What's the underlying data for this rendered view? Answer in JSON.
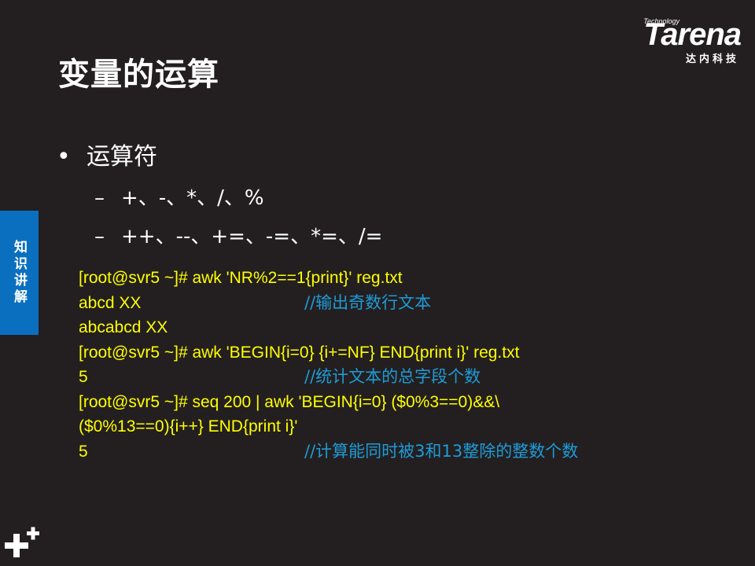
{
  "logo": {
    "technology": "Technology",
    "brand": "Tarena",
    "cn": "达内科技"
  },
  "title": "变量的运算",
  "bullet": "运算符",
  "sub_items": [
    "+、-、*、/、%",
    "++、--、+=、-=、*=、/="
  ],
  "side_tab": "知识讲解",
  "code_lines": [
    {
      "cmd": "[root@svr5 ~]# awk  'NR%2==1{print}'  reg.txt",
      "comment": ""
    },
    {
      "cmd": "abcd XX",
      "comment": "//输出奇数行文本"
    },
    {
      "cmd": "abcabcd XX",
      "comment": ""
    },
    {
      "cmd": "[root@svr5 ~]# awk  'BEGIN{i=0} {i+=NF} END{print i}'  reg.txt",
      "comment": ""
    },
    {
      "cmd": "5",
      "comment": "//统计文本的总字段个数"
    },
    {
      "cmd": "[root@svr5 ~]# seq  200 | awk  'BEGIN{i=0} ($0%3==0)&&\\",
      "comment": ""
    },
    {
      "cmd": "($0%13==0){i++} END{print i}'",
      "comment": ""
    },
    {
      "cmd": "5",
      "comment": "//计算能同时被3和13整除的整数个数"
    }
  ],
  "colors": {
    "background": "#231f20",
    "code": "#ffff00",
    "comment": "#1e9bd7",
    "side_tab": "#0b6fc0"
  }
}
